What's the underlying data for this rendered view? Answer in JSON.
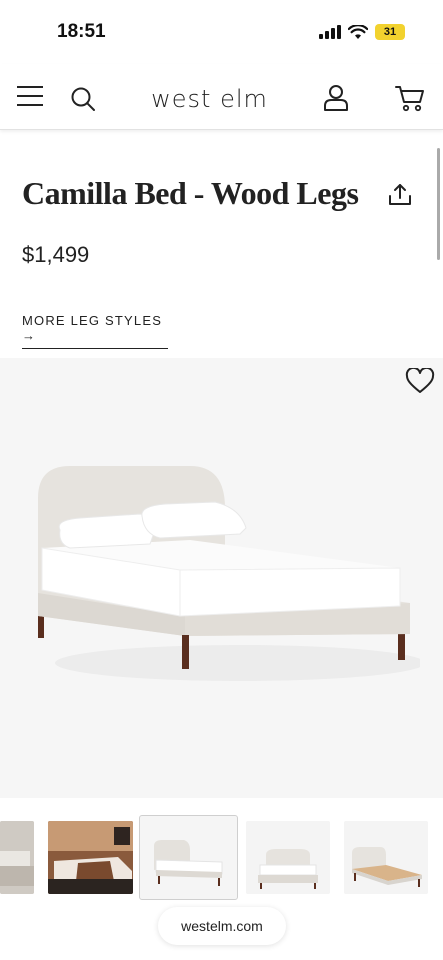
{
  "status_bar": {
    "time": "18:51",
    "battery": "31"
  },
  "header": {
    "logo": "west elm",
    "icons": [
      "menu-icon",
      "search-icon",
      "account-icon",
      "cart-icon"
    ]
  },
  "product": {
    "title": "Camilla Bed - Wood Legs",
    "price": "$1,499",
    "more_link": "MORE LEG STYLES →"
  },
  "hero": {
    "wishlist_icon": "heart-icon"
  },
  "thumbnails": [
    {
      "name": "thumb-1"
    },
    {
      "name": "thumb-2"
    },
    {
      "name": "thumb-3",
      "active": true
    },
    {
      "name": "thumb-4"
    },
    {
      "name": "thumb-5"
    }
  ],
  "browser": {
    "domain": "westelm.com"
  },
  "colors": {
    "text": "#222222",
    "battery": "#f2d22e",
    "upholstery": "#e6e3de",
    "legs": "#5a2e1e"
  }
}
